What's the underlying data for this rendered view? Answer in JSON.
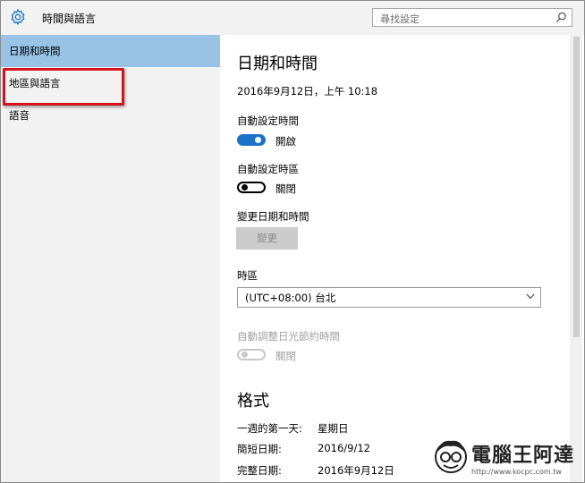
{
  "window": {
    "title": "時間與語言"
  },
  "search": {
    "placeholder": "尋找設定"
  },
  "sidebar": {
    "items": [
      {
        "label": "日期和時間",
        "active": true
      },
      {
        "label": "地區與語言",
        "active": false
      },
      {
        "label": "語音",
        "active": false
      }
    ]
  },
  "main": {
    "heading": "日期和時間",
    "current_datetime": "2016年9月12日，上午 10:18",
    "auto_time": {
      "label": "自動設定時間",
      "state_label": "開啟",
      "on": true
    },
    "auto_timezone": {
      "label": "自動設定時區",
      "state_label": "關閉",
      "on": false
    },
    "change_datetime": {
      "label": "變更日期和時間",
      "button_label": "變更"
    },
    "timezone": {
      "label": "時區",
      "selected": "(UTC+08:00) 台北"
    },
    "dst": {
      "label": "自動調整日光節約時間",
      "state_label": "關閉",
      "enabled": false
    },
    "format_heading": "格式",
    "formats": [
      {
        "label": "一週的第一天:",
        "value": "星期日"
      },
      {
        "label": "簡短日期:",
        "value": "2016/9/12"
      },
      {
        "label": "完整日期:",
        "value": "2016年9月12日"
      }
    ]
  },
  "watermark": {
    "title": "電腦王阿達",
    "url": "http://www.kocpc.com.tw"
  },
  "colors": {
    "accent": "#1a73c8",
    "sidebar_active": "#99c3e6",
    "highlight": "#d4141c"
  }
}
